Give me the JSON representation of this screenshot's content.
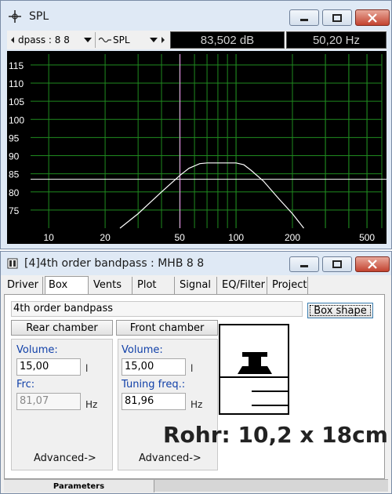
{
  "spl_window": {
    "title": "SPL",
    "toolbar": {
      "driver_select": "dpass : 8 8",
      "curve_select": "SPL",
      "readout_level": "83,502 dB",
      "readout_freq": "50,20 Hz"
    },
    "chart_data": {
      "type": "line",
      "x_scale": "log",
      "xlim": [
        8,
        600
      ],
      "ylim": [
        70,
        118
      ],
      "x_ticks": [
        "10",
        "20",
        "50",
        "100",
        "200",
        "500"
      ],
      "x_tick_values": [
        10,
        20,
        50,
        100,
        200,
        500
      ],
      "y_ticks": [
        "115",
        "110",
        "105",
        "100",
        "95",
        "90",
        "85",
        "80",
        "75"
      ],
      "y_tick_values": [
        115,
        110,
        105,
        100,
        95,
        90,
        85,
        80,
        75
      ],
      "grid": true,
      "cursor_x": 50.2,
      "reference_y": 83.5,
      "series": [
        {
          "x": [
            24,
            30,
            40,
            50,
            56,
            64,
            70,
            80,
            90,
            100,
            110,
            120,
            140,
            170,
            200,
            230
          ],
          "y": [
            70,
            74,
            80,
            84.5,
            86.5,
            87.8,
            88,
            88,
            88,
            88,
            87.5,
            86,
            83,
            78,
            74,
            70
          ]
        }
      ],
      "colors": {
        "background": "#000000",
        "grid": "#1f8a1f",
        "curve": "#ffffff",
        "cursor": "#ff9cff",
        "ticks": "#ffffff"
      }
    }
  },
  "box_window": {
    "title": "[4]4th order bandpass : MHB 8 8",
    "tabs": [
      "Driver",
      "Box",
      "Vents",
      "Plot",
      "Signal",
      "EQ/Filter",
      "Project"
    ],
    "active_tab": "Box",
    "box_type": "4th order bandpass",
    "box_shape_button": "Box shape",
    "rear_chamber": {
      "header": "Rear chamber",
      "volume_label": "Volume:",
      "volume_value": "15,00",
      "volume_unit": "l",
      "frc_label": "Frc:",
      "frc_value": "81,07",
      "frc_unit": "Hz",
      "advanced": "Advanced->"
    },
    "front_chamber": {
      "header": "Front chamber",
      "volume_label": "Volume:",
      "volume_value": "15,00",
      "volume_unit": "l",
      "tuning_label": "Tuning freq.:",
      "tuning_value": "81,96",
      "tuning_unit": "Hz",
      "advanced": "Advanced->"
    },
    "status": "Parameters"
  },
  "overlay_text": "Rohr: 10,2 x 18cm"
}
